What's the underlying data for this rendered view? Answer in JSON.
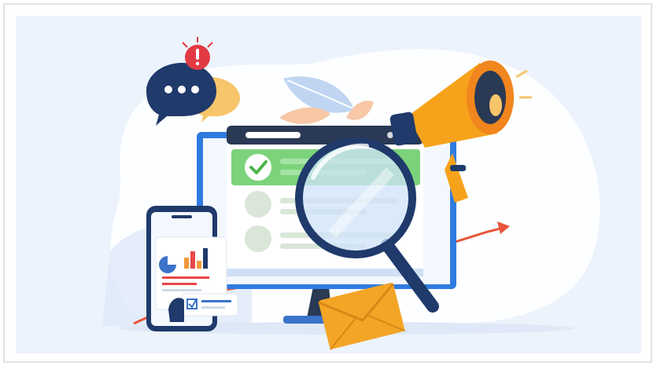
{
  "illustration": {
    "colors": {
      "background": "#edf3fc",
      "blob": "#ffffff",
      "monitor_frame": "#3a4f78",
      "monitor_screen": "#f3f8ff",
      "screen_bar": "#2a3954",
      "check_row": "#7cd37c",
      "check_badge": "#49b649",
      "placeholder": "#d9e6d8",
      "navy": "#1f3a6b",
      "megaphone": "#f7a21b",
      "envelope": "#f3a526",
      "alert": "#e23a43",
      "chart_blue": "#3a73c9",
      "chart_orange": "#f39a3b",
      "chart_red": "#e94848"
    },
    "icons": [
      "monitor-icon",
      "magnifier-icon",
      "megaphone-icon",
      "envelope-icon",
      "smartphone-icon",
      "chat-bubble-icon",
      "alert-badge-icon",
      "check-icon",
      "pie-chart-icon",
      "bar-chart-icon",
      "leaf-icon",
      "trend-arrow-icon"
    ]
  }
}
